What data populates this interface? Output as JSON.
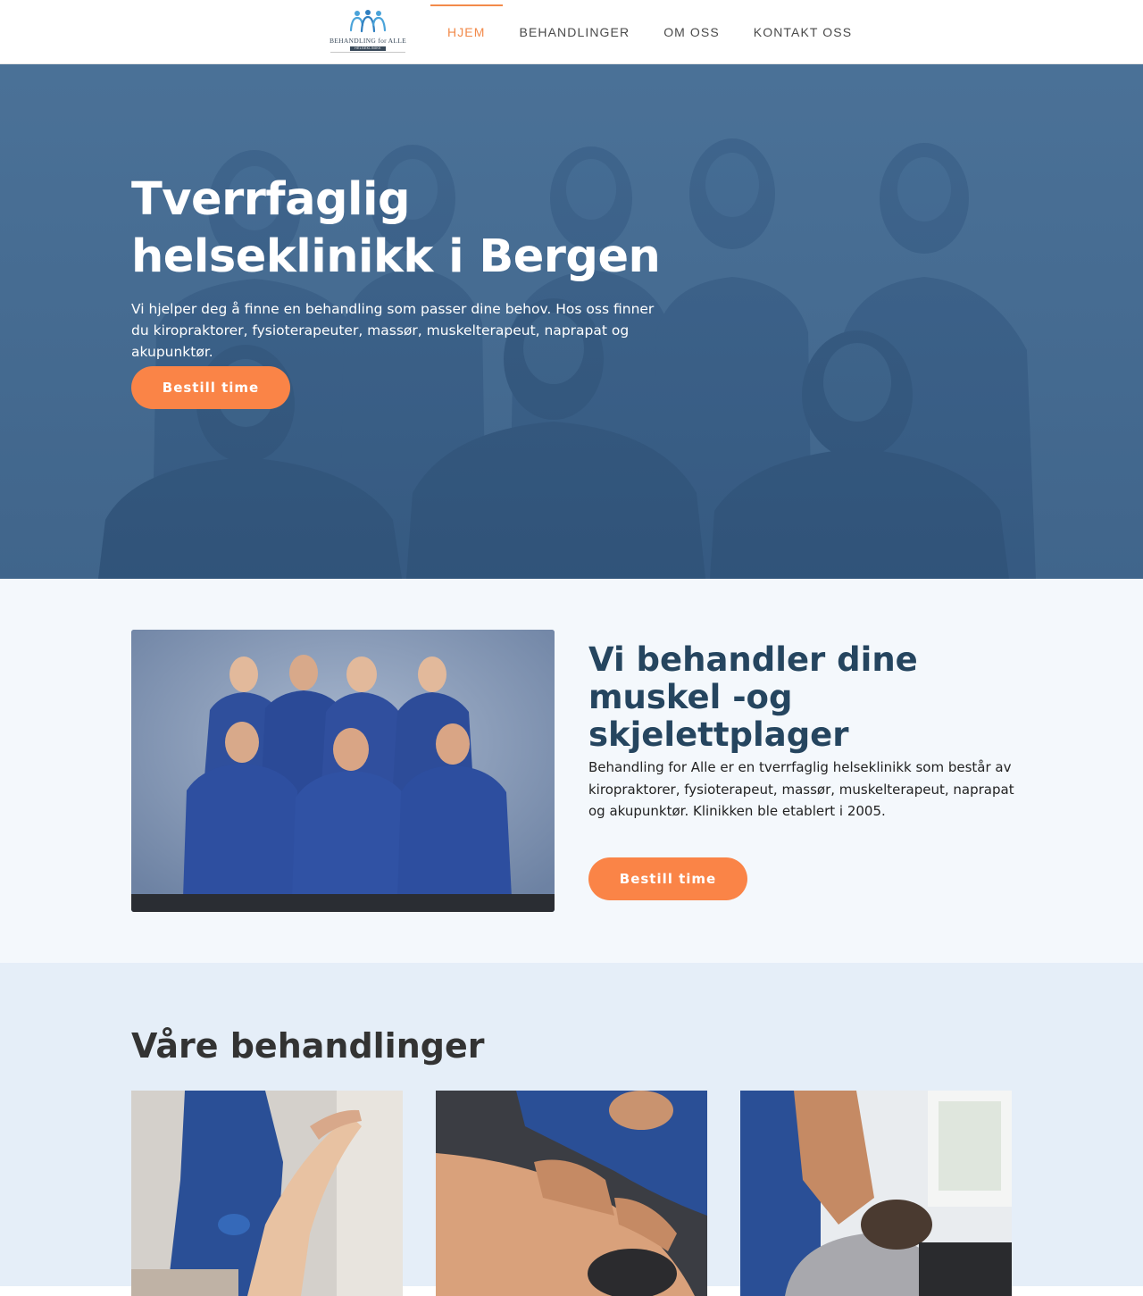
{
  "header": {
    "logo": {
      "wordmark": "BEHANDLING for ALLE",
      "subline": "HELSEKLINIKK"
    },
    "nav": [
      {
        "label": "HJEM",
        "active": true
      },
      {
        "label": "BEHANDLINGER",
        "active": false
      },
      {
        "label": "OM OSS",
        "active": false
      },
      {
        "label": "KONTAKT OSS",
        "active": false
      }
    ]
  },
  "hero": {
    "title_line1": "Tverrfaglig",
    "title_line2": "helseklinikk i Bergen",
    "text": "Vi hjelper deg å finne en behandling som passer dine behov. Hos oss finner du kiropraktorer, fysioterapeuter, massør, muskelterapeut, naprapat og akupunktør.",
    "button": "Bestill time"
  },
  "about": {
    "title": "Vi behandler dine muskel -og skjelettplager",
    "text": "Behandling for Alle er en tverrfaglig helseklinikk som består av kiropraktorer, fysioterapeut, massør, muskelterapeut, naprapat og akupunktør. Klinikken ble etablert i 2005.",
    "button": "Bestill time"
  },
  "treatments": {
    "title": "Våre behandlinger",
    "cards": [
      {
        "image": "treatment-photo-stretch"
      },
      {
        "image": "treatment-photo-massage"
      },
      {
        "image": "treatment-photo-back-treatment"
      }
    ]
  },
  "colors": {
    "accent": "#fa8447",
    "hero_tint": "#4a7094",
    "navy_heading": "#25455f",
    "about_bg": "#f4f8fc",
    "treatments_bg": "#e5eef8"
  }
}
